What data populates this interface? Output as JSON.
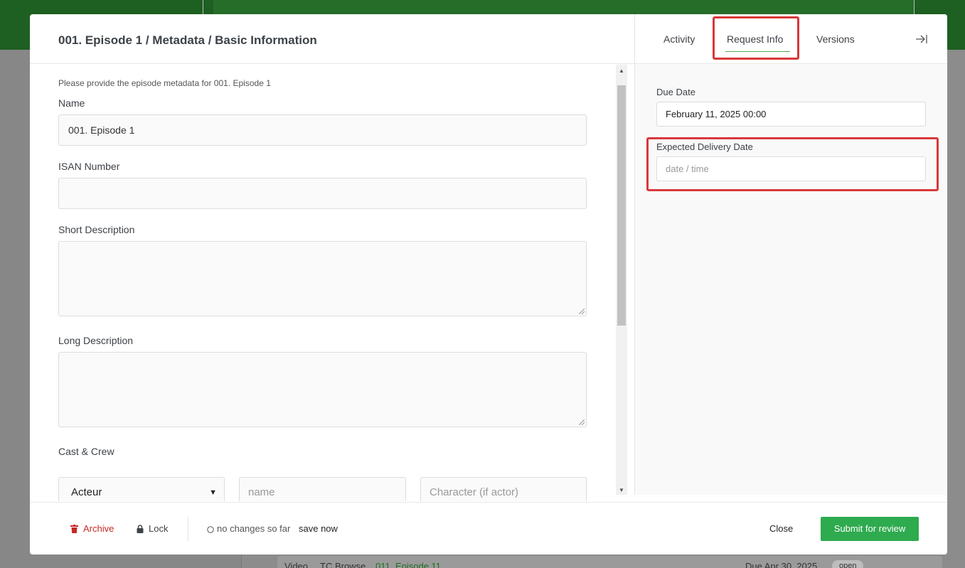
{
  "modal": {
    "title": "001. Episode 1 / Metadata / Basic Information"
  },
  "form": {
    "intro": "Please provide the episode metadata for 001. Episode 1",
    "name_label": "Name",
    "name_value": "001. Episode 1",
    "isan_label": "ISAN Number",
    "isan_value": "",
    "short_desc_label": "Short Description",
    "long_desc_label": "Long Description",
    "cast_label": "Cast & Crew",
    "role_selected": "Acteur",
    "name_placeholder": "name",
    "character_placeholder": "Character (if actor)"
  },
  "right_panel": {
    "tabs": [
      {
        "label": "Activity"
      },
      {
        "label": "Request Info",
        "active": true
      },
      {
        "label": "Versions"
      }
    ],
    "due_date_label": "Due Date",
    "due_date_value": "February 11, 2025 00:00",
    "expected_label": "Expected Delivery Date",
    "expected_placeholder": "date / time"
  },
  "footer": {
    "archive_label": "Archive",
    "lock_label": "Lock",
    "status_text": "no changes so far",
    "save_now_label": "save now",
    "close_label": "Close",
    "submit_label": "Submit for review"
  },
  "background": {
    "row": {
      "type": "Video",
      "kind": "TC Browse",
      "episode": "011. Episode 11",
      "due": "Due Apr 30, 2025",
      "status": "open"
    }
  },
  "colors": {
    "accent_green": "#2eaa4f",
    "highlight_red": "#d9383a",
    "archive_red": "#c62828",
    "topbar_green": "#1e5f22"
  },
  "icons": {
    "archive": "trash-icon",
    "lock": "lock-icon",
    "status": "circle-icon",
    "collapse": "collapse-right-icon",
    "select": "chevron-down-icon"
  }
}
